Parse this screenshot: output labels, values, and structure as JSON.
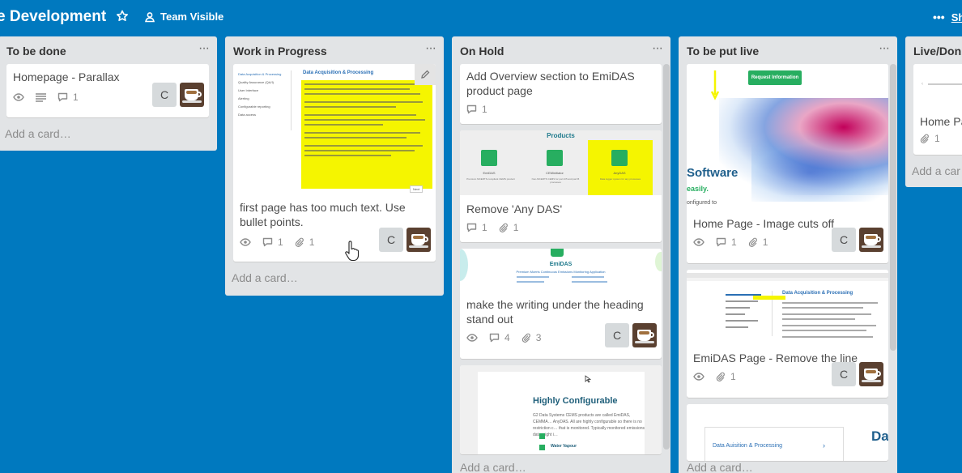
{
  "header": {
    "board_title": "e Development",
    "visibility_label": "Team Visible",
    "show_menu_label": "Sh"
  },
  "lists": [
    {
      "title": "To be done",
      "add_card": "Add a card…",
      "cards": [
        {
          "title": "Homepage - Parallax",
          "comments": "1",
          "member_initial": "C"
        }
      ]
    },
    {
      "title": "Work in Progress",
      "add_card": "Add a card…",
      "cards": [
        {
          "title": "first page has too much text. Use bullet points.",
          "comments": "1",
          "attachments": "1",
          "member_initial": "C",
          "cover_heading": "Data Acquisition & Processing",
          "cover_menu": [
            "Data Acquisition & Processing",
            "Quality Assurance (QA/I)",
            "User Interface",
            "Alerting",
            "Configurable reporting",
            "Data access"
          ],
          "cover_next": "Next"
        }
      ]
    },
    {
      "title": "On Hold",
      "add_card": "Add a card…",
      "cards": [
        {
          "title": "Add Overview section to EmiDAS product page",
          "comments": "1"
        },
        {
          "title": "Remove 'Any DAS'",
          "comments": "1",
          "attachments": "1",
          "cover_heading": "Products",
          "products": [
            {
              "name": "EmiDAS",
              "desc": "Premium MCERTS compliant CEMS product"
            },
            {
              "name": "CEMinitiator",
              "desc": "Non-MCERTS CEMS for part 4/5 and part B processes"
            },
            {
              "name": "AnyDAS",
              "desc": "Data logger system for any processes"
            }
          ]
        },
        {
          "title": "make the writing under the heading stand out",
          "comments": "4",
          "attachments": "3",
          "member_initial": "C",
          "cover_heading": "EmiDAS",
          "cover_sub": "Premium Mcerts Continuous Emissions Monitoring Application"
        },
        {
          "cover_heading": "Highly Configurable",
          "cover_text": "G2 Data Systems CEMS products are called EmiDAS, CEMMA… AnyDAS. All are highly configurable so there is no restriction c… that is monitored. Typically monitored emissions data might i…",
          "cover_item": "Water Vapour"
        }
      ]
    },
    {
      "title": "To be put live",
      "add_card": "Add a card…",
      "cards": [
        {
          "title": "Home Page - Image cuts off",
          "comments": "1",
          "attachments": "1",
          "member_initial": "C",
          "cover_button": "Request Information",
          "cover_software": "Software",
          "cover_easily": "easily.",
          "cover_configured": "onfigured to"
        },
        {
          "title": "EmiDAS Page - Remove the line",
          "attachments": "1",
          "member_initial": "C",
          "cover_heading": "Data Acquisition & Processing"
        },
        {
          "cover_heading": "Data Auisition & Processing",
          "cover_big": "Da"
        }
      ]
    },
    {
      "title": "Live/Don",
      "add_card": "Add a car",
      "cards": [
        {
          "title": "Home Pa",
          "attachments": "1"
        }
      ]
    }
  ],
  "colors": {
    "board_bg": "#0079bf",
    "list_bg": "#e2e4e6",
    "card_bg": "#ffffff",
    "highlight_yellow": "#f5f500",
    "product_green": "#27ae60",
    "request_button": "#27ae60",
    "link_blue": "#2a6fb5"
  }
}
